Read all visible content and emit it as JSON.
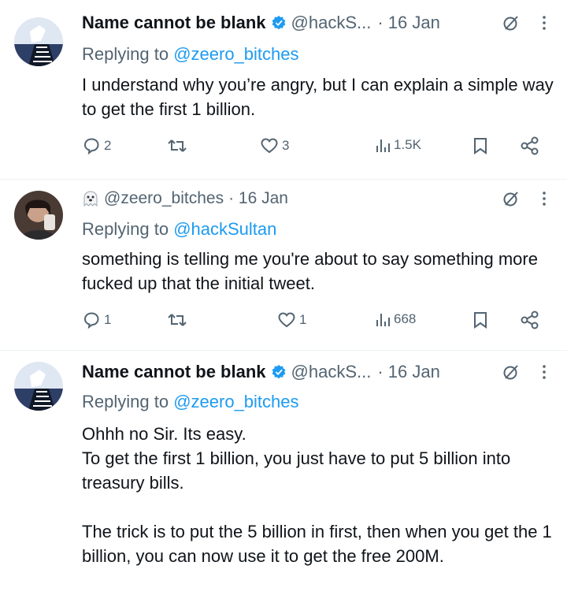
{
  "tweets": [
    {
      "name": "Name cannot be blank",
      "handle": "@hackS...",
      "date": "· 16 Jan",
      "replying_prefix": "Replying to",
      "replying_to": "@zeero_bitches",
      "body": [
        "I understand why you’re angry, but I can explain a simple way to get the first 1 billion."
      ],
      "replies": "2",
      "likes": "3",
      "views": "1.5K"
    },
    {
      "handle": "@zeero_bitches",
      "date": "· 16 Jan",
      "replying_prefix": "Replying to",
      "replying_to": "@hackSultan",
      "body": [
        "something is telling me you're about to say something more fucked up that the initial tweet."
      ],
      "replies": "1",
      "likes": "1",
      "views": "668"
    },
    {
      "name": "Name cannot be blank",
      "handle": "@hackS...",
      "date": "· 16 Jan",
      "replying_prefix": "Replying to",
      "replying_to": "@zeero_bitches",
      "body": [
        "Ohhh no Sir.  Its easy.",
        "To get the first 1 billion, you just have to put 5 billion into treasury bills.",
        "",
        "The trick is to put the 5 billion in first, then when you get the 1 billion, you can now use it to get the free 200M."
      ]
    }
  ],
  "colors": {
    "accent": "#1d9bf0",
    "secondary_text": "#536471",
    "primary_text": "#0f1419"
  },
  "icons": [
    "verified-badge-icon",
    "grok-icon",
    "more-icon",
    "reply-icon",
    "retweet-icon",
    "like-icon",
    "views-icon",
    "bookmark-icon",
    "share-icon",
    "ghost-emoji-icon"
  ]
}
